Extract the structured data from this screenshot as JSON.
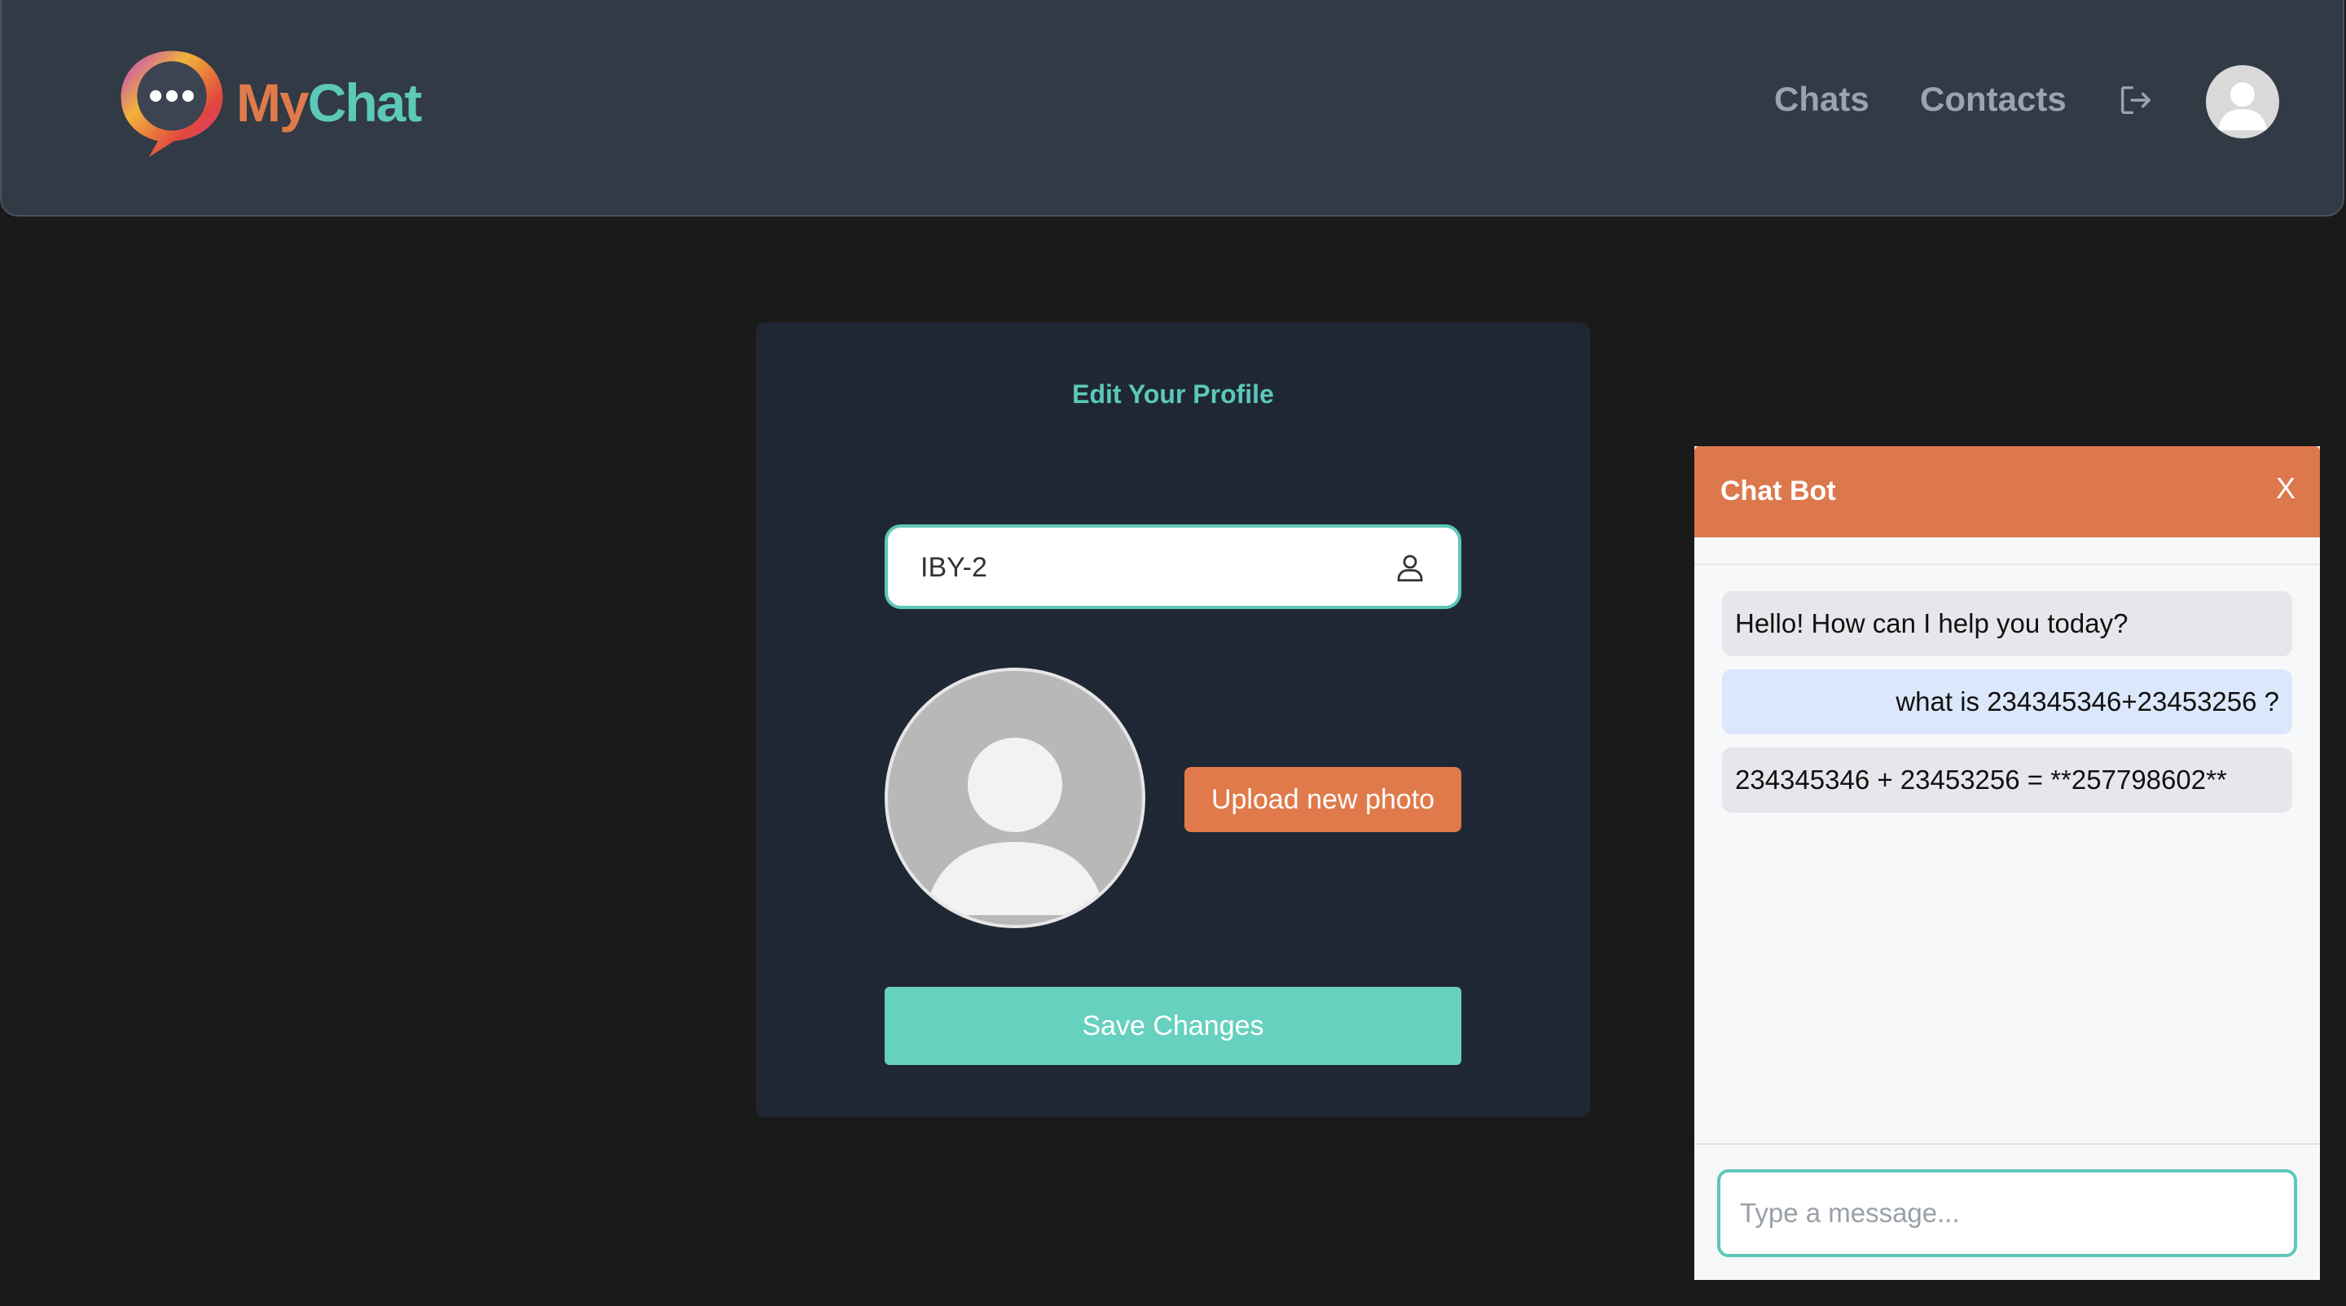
{
  "app": {
    "brand_part1": "My",
    "brand_part2": "Chat"
  },
  "nav": {
    "chats": "Chats",
    "contacts": "Contacts"
  },
  "icons": {
    "logo": "chat-bubble-logo-icon",
    "logout": "logout-icon",
    "avatar": "user-avatar-icon",
    "user": "user-icon"
  },
  "profile": {
    "title": "Edit Your Profile",
    "username_value": "IBY-2",
    "upload_label": "Upload new photo",
    "save_label": "Save Changes"
  },
  "chatbot": {
    "title": "Chat Bot",
    "close_label": "X",
    "messages": [
      {
        "role": "bot",
        "text": "Hello! How can I help you today?"
      },
      {
        "role": "user",
        "text": "what is 234345346+23453256 ?"
      },
      {
        "role": "bot",
        "text": "234345346 + 23453256 = **257798602**"
      }
    ],
    "input_placeholder": "Type a message..."
  },
  "colors": {
    "accent_teal": "#5cc8b8",
    "accent_orange": "#e07a4a",
    "header_bg": "#313a45",
    "card_bg": "#1f2735",
    "page_bg": "#1a1a1a"
  }
}
